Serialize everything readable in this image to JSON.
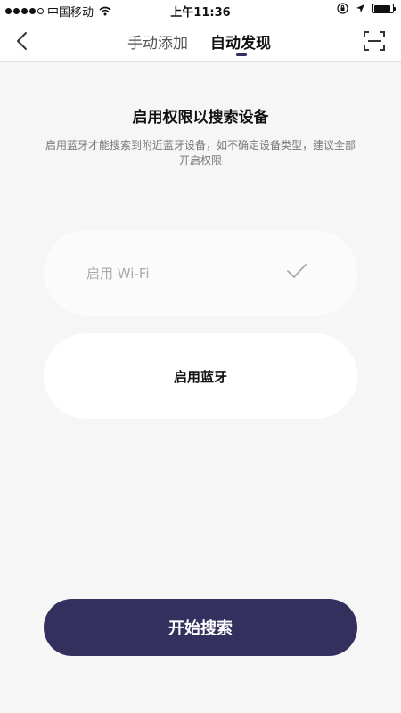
{
  "status_bar": {
    "carrier": "中国移动",
    "time": "上午11:36",
    "signal_strength": 4,
    "battery_level": 0.9
  },
  "nav": {
    "tabs": [
      {
        "label": "手动添加",
        "active": false
      },
      {
        "label": "自动发现",
        "active": true
      }
    ],
    "icons": {
      "back": "chevron-left-icon",
      "scan": "scan-icon"
    }
  },
  "main": {
    "title": "启用权限以搜索设备",
    "subtitle": "启用蓝牙才能搜索到附近蓝牙设备，如不确定设备类型，建议全部开启权限",
    "permissions": [
      {
        "label": "启用 Wi-Fi",
        "enabled": true
      },
      {
        "label": "启用蓝牙",
        "enabled": false
      }
    ],
    "start_button": "开始搜索"
  },
  "colors": {
    "accent": "#34305e",
    "background": "#f6f6f6",
    "card": "#ffffff",
    "muted_text": "#aaaaaa"
  }
}
